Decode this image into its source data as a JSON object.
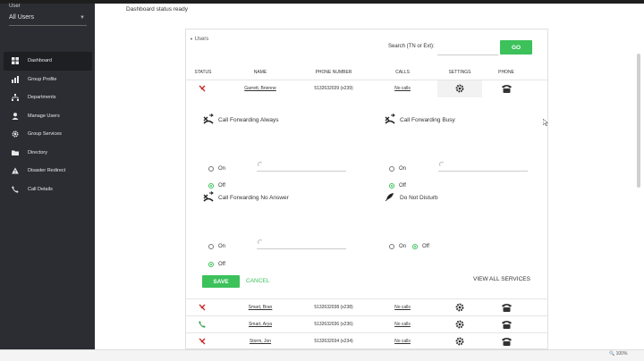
{
  "sidebar": {
    "user_label": "User",
    "user_select_value": "All Users",
    "items": [
      {
        "label": "Dashboard",
        "icon": "grid-icon",
        "active": true
      },
      {
        "label": "Group Profile",
        "icon": "chart-icon"
      },
      {
        "label": "Departments",
        "icon": "org-chart-icon"
      },
      {
        "label": "Manage Users",
        "icon": "user-icon"
      },
      {
        "label": "Group Services",
        "icon": "gear-icon"
      },
      {
        "label": "Directory",
        "icon": "folder-icon"
      },
      {
        "label": "Disaster Redirect",
        "icon": "warning-icon"
      },
      {
        "label": "Call Details",
        "icon": "phone-icon"
      }
    ]
  },
  "main": {
    "status_text": "Dashboard status ready"
  },
  "users_panel": {
    "title": "Users",
    "search_label": "Search (TN or Ext):",
    "search_value": "",
    "go_label": "GO",
    "columns": [
      "STATUS",
      "NAME",
      "PHONE NUMBER",
      "CALLS",
      "SETTINGS",
      "PHONE"
    ],
    "expanded_user": {
      "name": "Garrett, Brienne",
      "phone": "5132632039 (x239)",
      "calls": "No calls",
      "status": "unavailable"
    },
    "users": [
      {
        "name": "Smart, Bran",
        "phone": "5132632038 (x238)",
        "calls": "No calls",
        "status": "unavailable"
      },
      {
        "name": "Smart, Arya",
        "phone": "5132632036 (x236)",
        "calls": "No calls",
        "status": "available"
      },
      {
        "name": "Storm, Jon",
        "phone": "5132632034 (x234)",
        "calls": "No calls",
        "status": "unavailable"
      }
    ]
  },
  "services": {
    "cfa": {
      "title": "Call Forwarding Always",
      "on_label": "On",
      "off_label": "Off",
      "selected": "off"
    },
    "cfb": {
      "title": "Call Forwarding Busy",
      "on_label": "On",
      "off_label": "Off",
      "selected": "off"
    },
    "cfna": {
      "title": "Call Forwarding No Answer",
      "on_label": "On",
      "off_label": "Off",
      "selected": "off"
    },
    "dnd": {
      "title": "Do Not Disturb",
      "on_label": "On",
      "off_label": "Off",
      "selected": "off"
    },
    "save_label": "SAVE",
    "cancel_label": "CANCEL",
    "view_all_label": "VIEW ALL SERVICES"
  },
  "statusbar": {
    "zoom": "100%"
  },
  "colors": {
    "accent": "#3cc15b",
    "sidebar_bg": "#2b2d33",
    "unavailable": "#c62828",
    "available": "#2e9e44"
  }
}
